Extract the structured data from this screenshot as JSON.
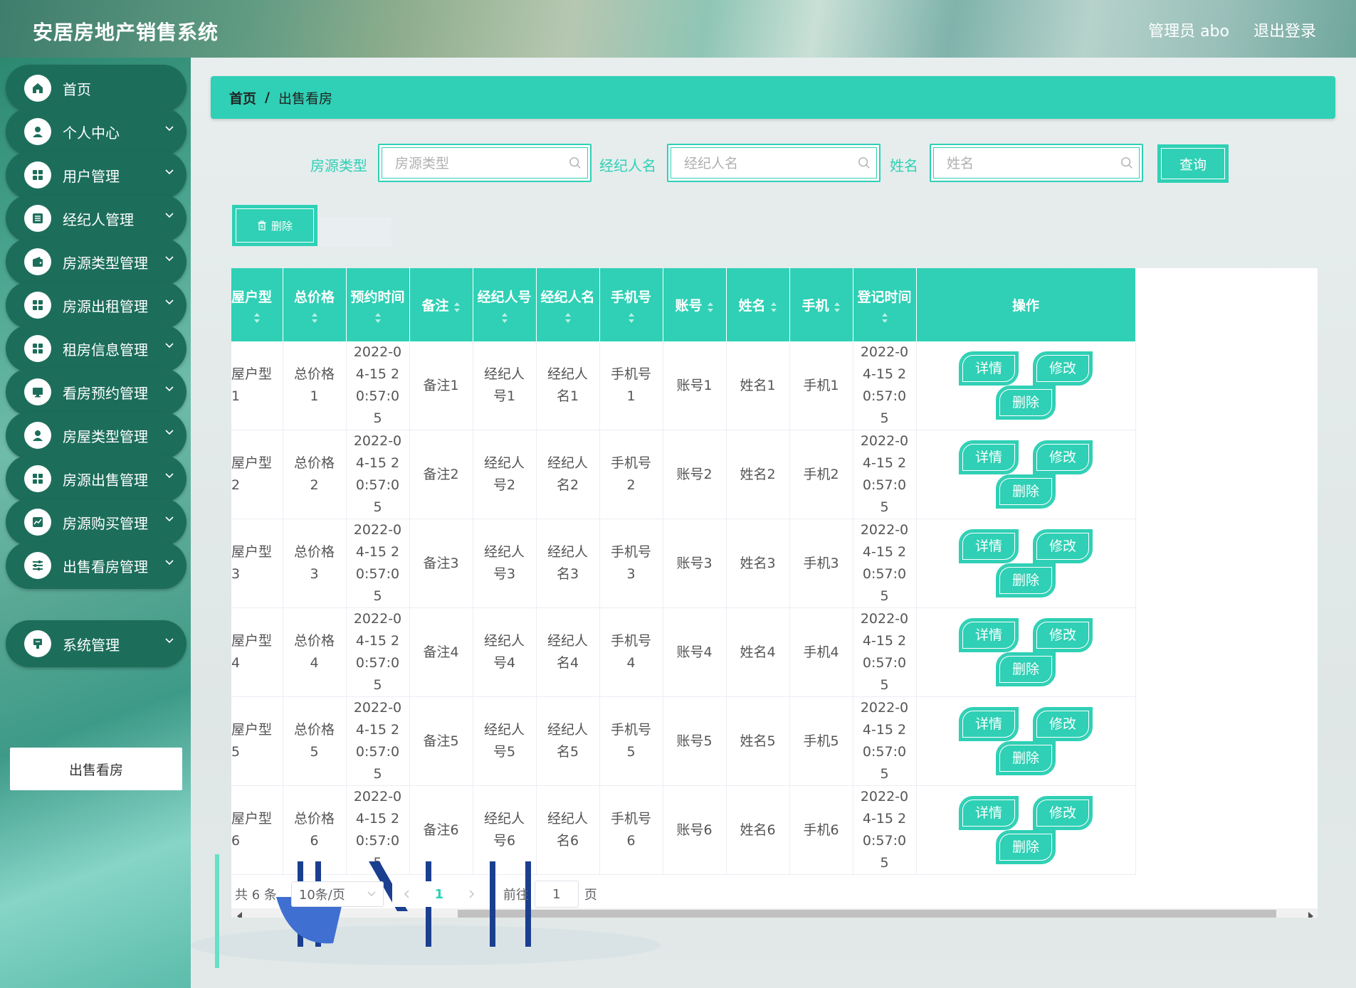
{
  "header": {
    "title": "安居房地产销售系统",
    "user": "管理员 abo",
    "logout": "退出登录"
  },
  "sidebar": {
    "items": [
      {
        "label": "首页",
        "icon": "home-icon"
      },
      {
        "label": "个人中心",
        "icon": "user-icon"
      },
      {
        "label": "用户管理",
        "icon": "grid-icon"
      },
      {
        "label": "经纪人管理",
        "icon": "list-icon"
      },
      {
        "label": "房源类型管理",
        "icon": "wallet-icon"
      },
      {
        "label": "房源出租管理",
        "icon": "grid-icon"
      },
      {
        "label": "租房信息管理",
        "icon": "grid-icon"
      },
      {
        "label": "看房预约管理",
        "icon": "monitor-icon"
      },
      {
        "label": "房屋类型管理",
        "icon": "user-icon"
      },
      {
        "label": "房源出售管理",
        "icon": "grid-icon"
      },
      {
        "label": "房源购买管理",
        "icon": "chart-icon"
      },
      {
        "label": "出售看房管理",
        "icon": "sliders-icon"
      },
      {
        "label": "系统管理",
        "icon": "cup-icon"
      }
    ],
    "submenu_label": "出售看房"
  },
  "breadcrumb": {
    "home": "首页",
    "sep": "/",
    "current": "出售看房"
  },
  "search": {
    "type_label": "房源类型",
    "type_placeholder": "房源类型",
    "agent_label": "经纪人名",
    "agent_placeholder": "经纪人名",
    "name_label": "姓名",
    "name_placeholder": "姓名",
    "query_button": "查询"
  },
  "toolbar": {
    "delete_label": "删除"
  },
  "table": {
    "headers": [
      "屋户型",
      "总价格",
      "预约时间",
      "备注",
      "经纪人号",
      "经纪人名",
      "手机号",
      "账号",
      "姓名",
      "手机",
      "登记时间",
      "操作"
    ],
    "rows": [
      [
        "屋户型1",
        "总价格1",
        "2022-04-15 20:57:05",
        "备注1",
        "经纪人号1",
        "经纪人名1",
        "手机号1",
        "账号1",
        "姓名1",
        "手机1",
        "2022-04-15 20:57:05"
      ],
      [
        "屋户型2",
        "总价格2",
        "2022-04-15 20:57:05",
        "备注2",
        "经纪人号2",
        "经纪人名2",
        "手机号2",
        "账号2",
        "姓名2",
        "手机2",
        "2022-04-15 20:57:05"
      ],
      [
        "屋户型3",
        "总价格3",
        "2022-04-15 20:57:05",
        "备注3",
        "经纪人号3",
        "经纪人名3",
        "手机号3",
        "账号3",
        "姓名3",
        "手机3",
        "2022-04-15 20:57:05"
      ],
      [
        "屋户型4",
        "总价格4",
        "2022-04-15 20:57:05",
        "备注4",
        "经纪人号4",
        "经纪人名4",
        "手机号4",
        "账号4",
        "姓名4",
        "手机4",
        "2022-04-15 20:57:05"
      ],
      [
        "屋户型5",
        "总价格5",
        "2022-04-15 20:57:05",
        "备注5",
        "经纪人号5",
        "经纪人名5",
        "手机号5",
        "账号5",
        "姓名5",
        "手机5",
        "2022-04-15 20:57:05"
      ],
      [
        "屋户型6",
        "总价格6",
        "2022-04-15 20:57:05",
        "备注6",
        "经纪人号6",
        "经纪人名6",
        "手机号6",
        "账号6",
        "姓名6",
        "手机6",
        "2022-04-15 20:57:05"
      ]
    ],
    "actions": {
      "detail": "详情",
      "edit": "修改",
      "delete": "删除"
    }
  },
  "pagination": {
    "total": "共 6 条",
    "page_size": "10条/页",
    "current_page": "1",
    "goto_prefix": "前往",
    "goto_value": "1",
    "goto_suffix": "页"
  },
  "colors": {
    "accent": "#2fd0b5",
    "sidebar_item": "#1c6e5b"
  }
}
